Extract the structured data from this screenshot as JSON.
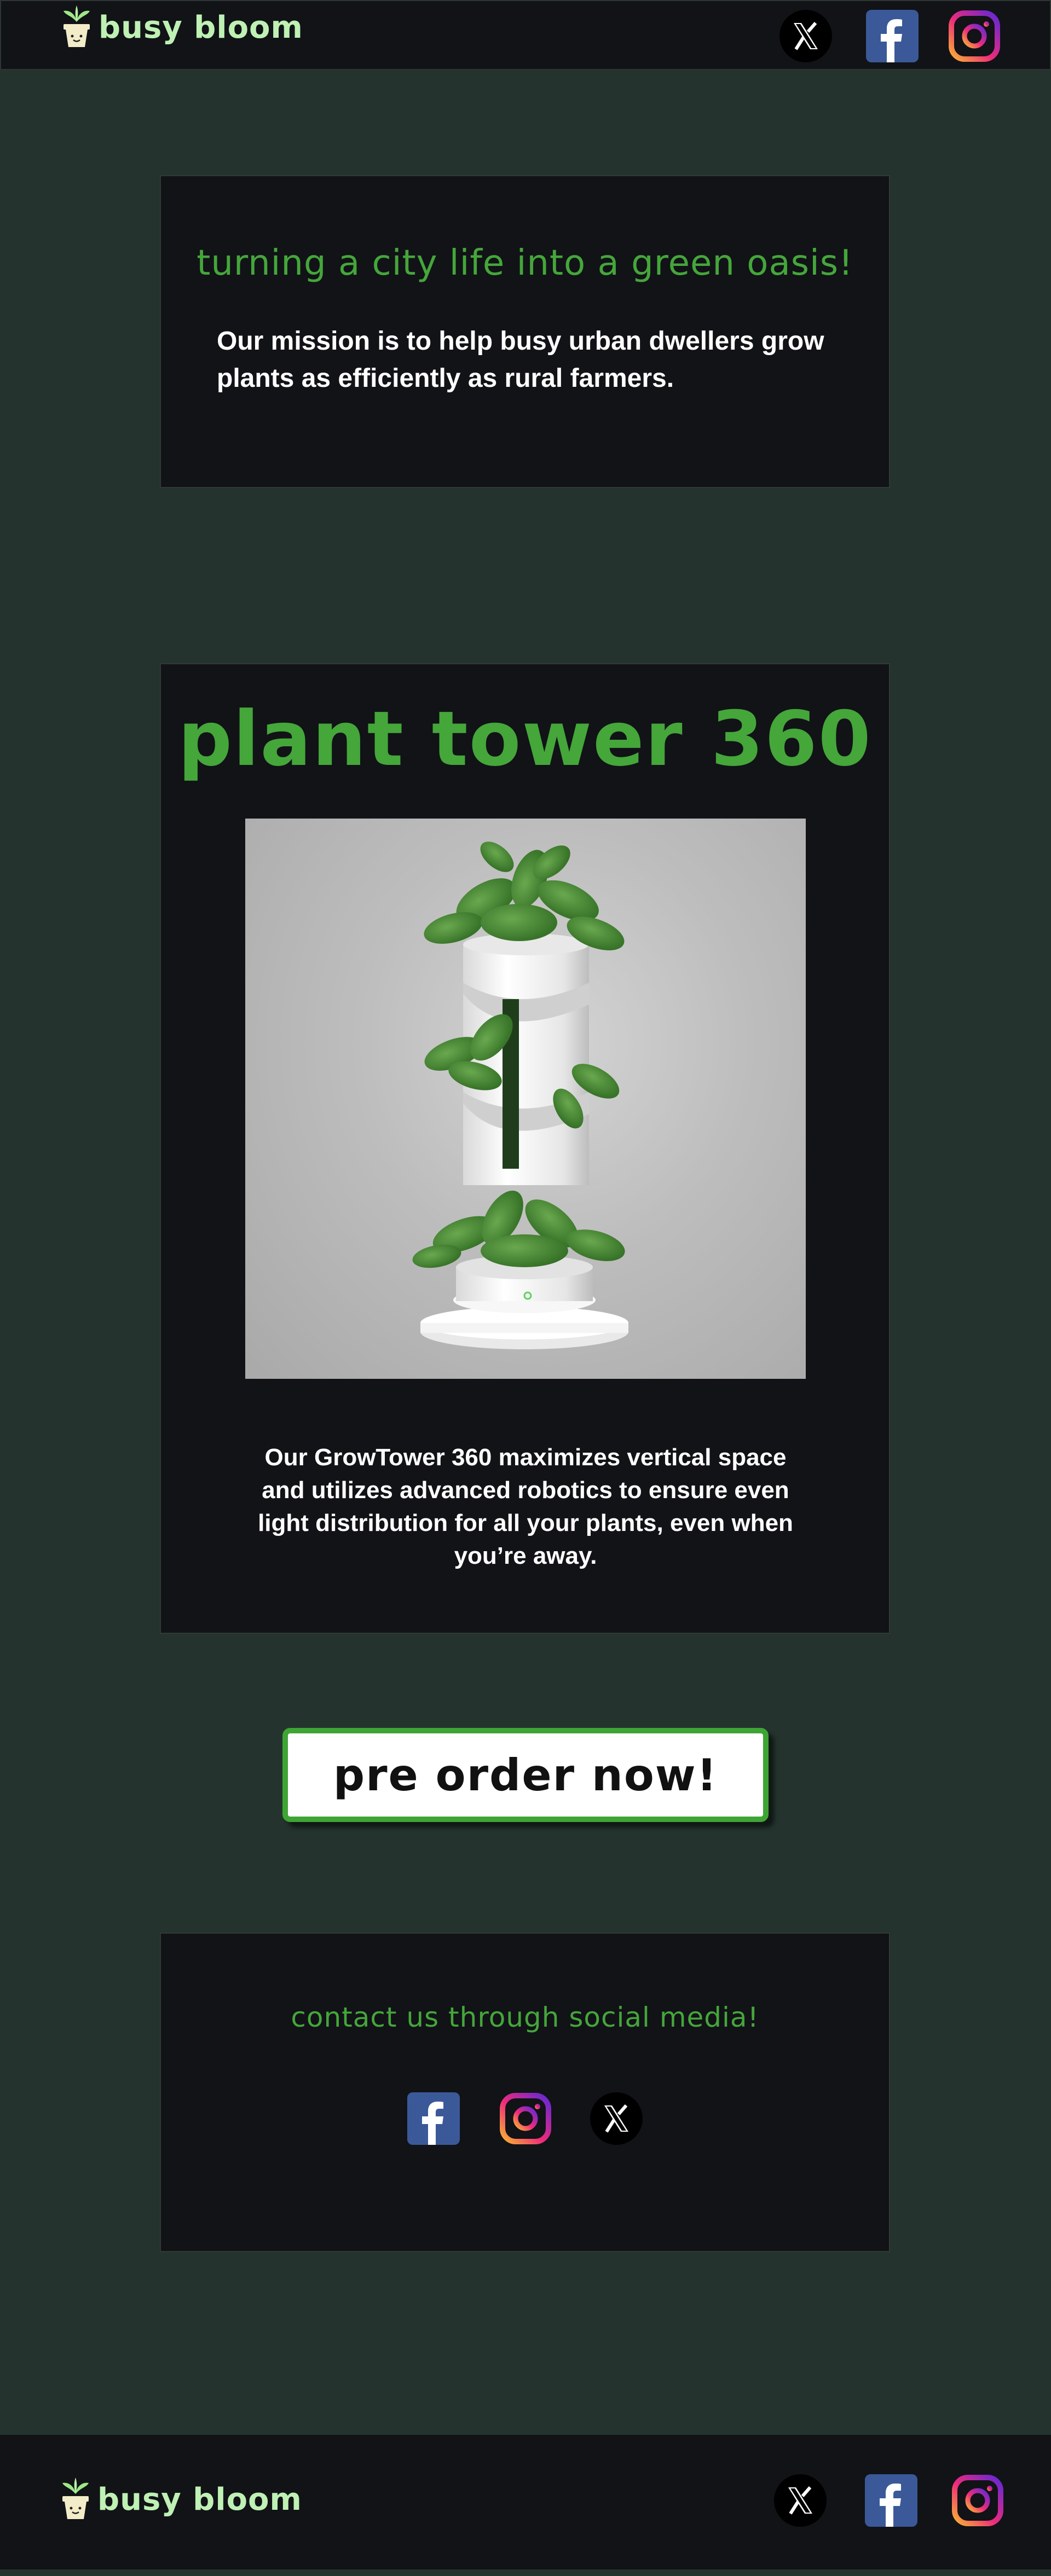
{
  "header": {
    "brand": "busy bloom",
    "social": [
      {
        "icon": "x-icon",
        "label": "X"
      },
      {
        "icon": "facebook-icon",
        "label": "Facebook"
      },
      {
        "icon": "instagram-icon",
        "label": "Instagram"
      }
    ]
  },
  "mission": {
    "tagline": "turning a city life into a green oasis!",
    "text": "Our mission is to help busy urban dwellers grow plants as efficiently as rural farmers."
  },
  "product": {
    "title": "plant tower 360",
    "image_alt": "White spiral vertical planter tower with leafy green plants",
    "description": "Our GrowTower 360 maximizes vertical space and utilizes advanced robotics to ensure even light distribution for all your plants, even when you’re away."
  },
  "cta": {
    "label": "pre order now!"
  },
  "contact": {
    "title": "contact us through social media!"
  },
  "footer": {
    "brand": "busy bloom"
  },
  "colors": {
    "page_bg": "#24332e",
    "panel_bg": "#111317",
    "accent_green": "#45a63a",
    "brand_text": "#bff0b4",
    "facebook_blue": "#3b5998"
  }
}
